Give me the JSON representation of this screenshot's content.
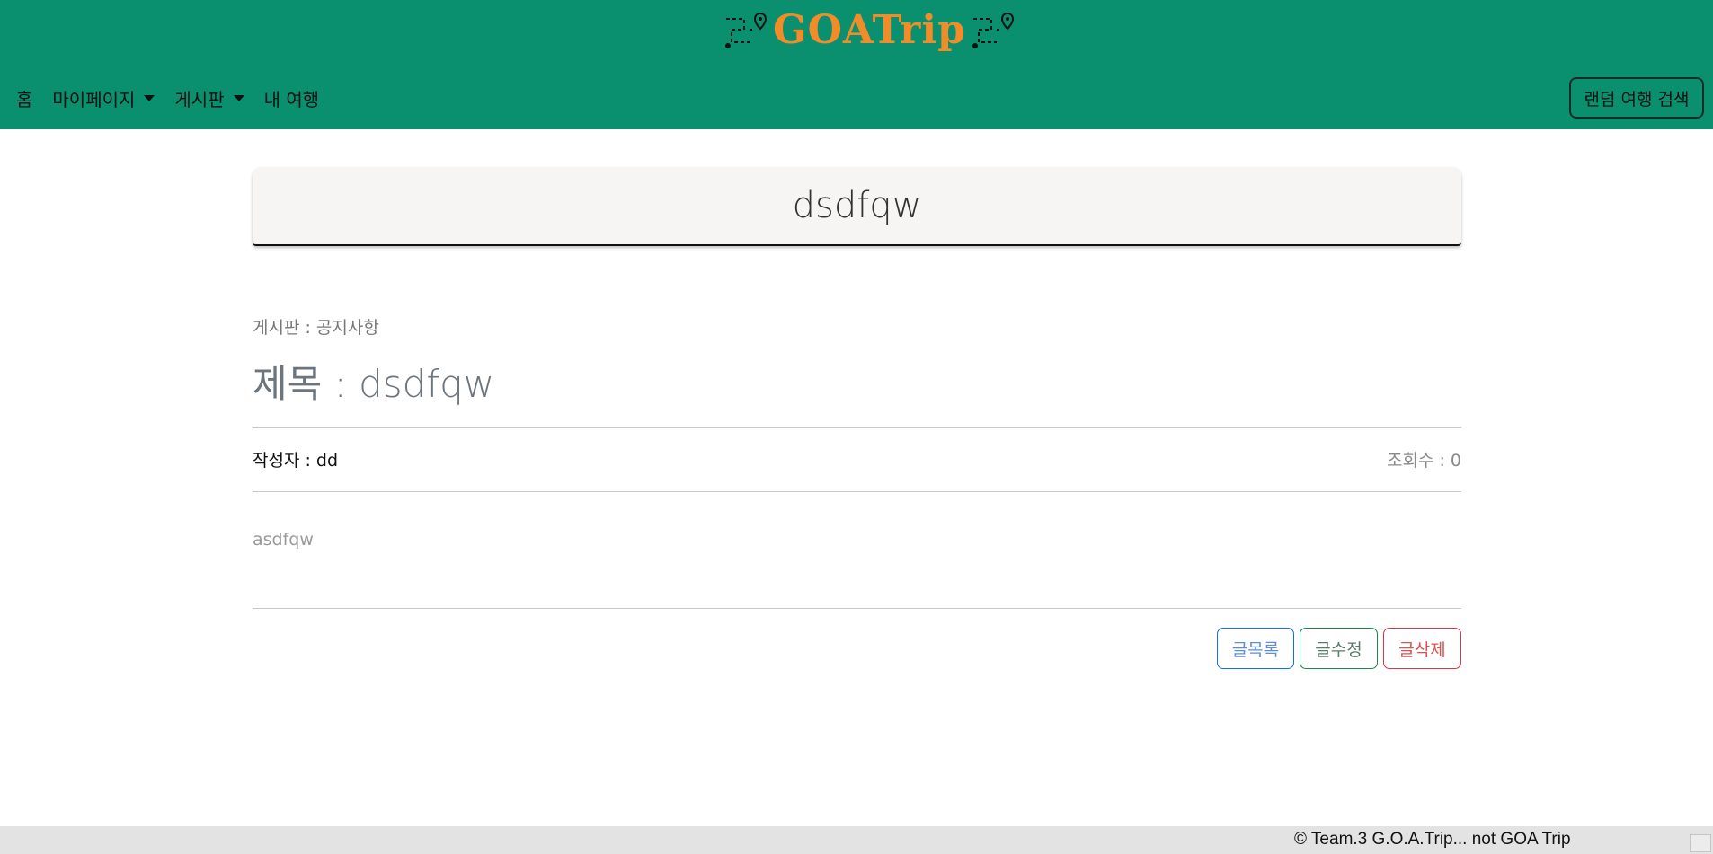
{
  "header": {
    "brand": "GOATrip",
    "colors": {
      "topbar": "#0a8f6f",
      "brand": "#f28c28"
    },
    "icons": [
      "route-map-pin-icon",
      "route-map-pin-icon"
    ]
  },
  "nav": {
    "home": "홈",
    "mypage": "마이페이지",
    "board": "게시판",
    "mytrip": "내 여행"
  },
  "random_search_label": "랜덤 여행 검색",
  "post": {
    "header_title": "dsdfqw",
    "board_label": "게시판 : 공지사항",
    "title_label": "제목 : dsdfqw",
    "author_label": "작성자 : dd",
    "views_label": "조회수 : 0",
    "content": "asdfqw"
  },
  "buttons": {
    "list": "글목록",
    "edit": "글수정",
    "delete": "글삭제"
  },
  "footer": {
    "text": "© Team.3 G.O.A.Trip... not GOA Trip"
  }
}
